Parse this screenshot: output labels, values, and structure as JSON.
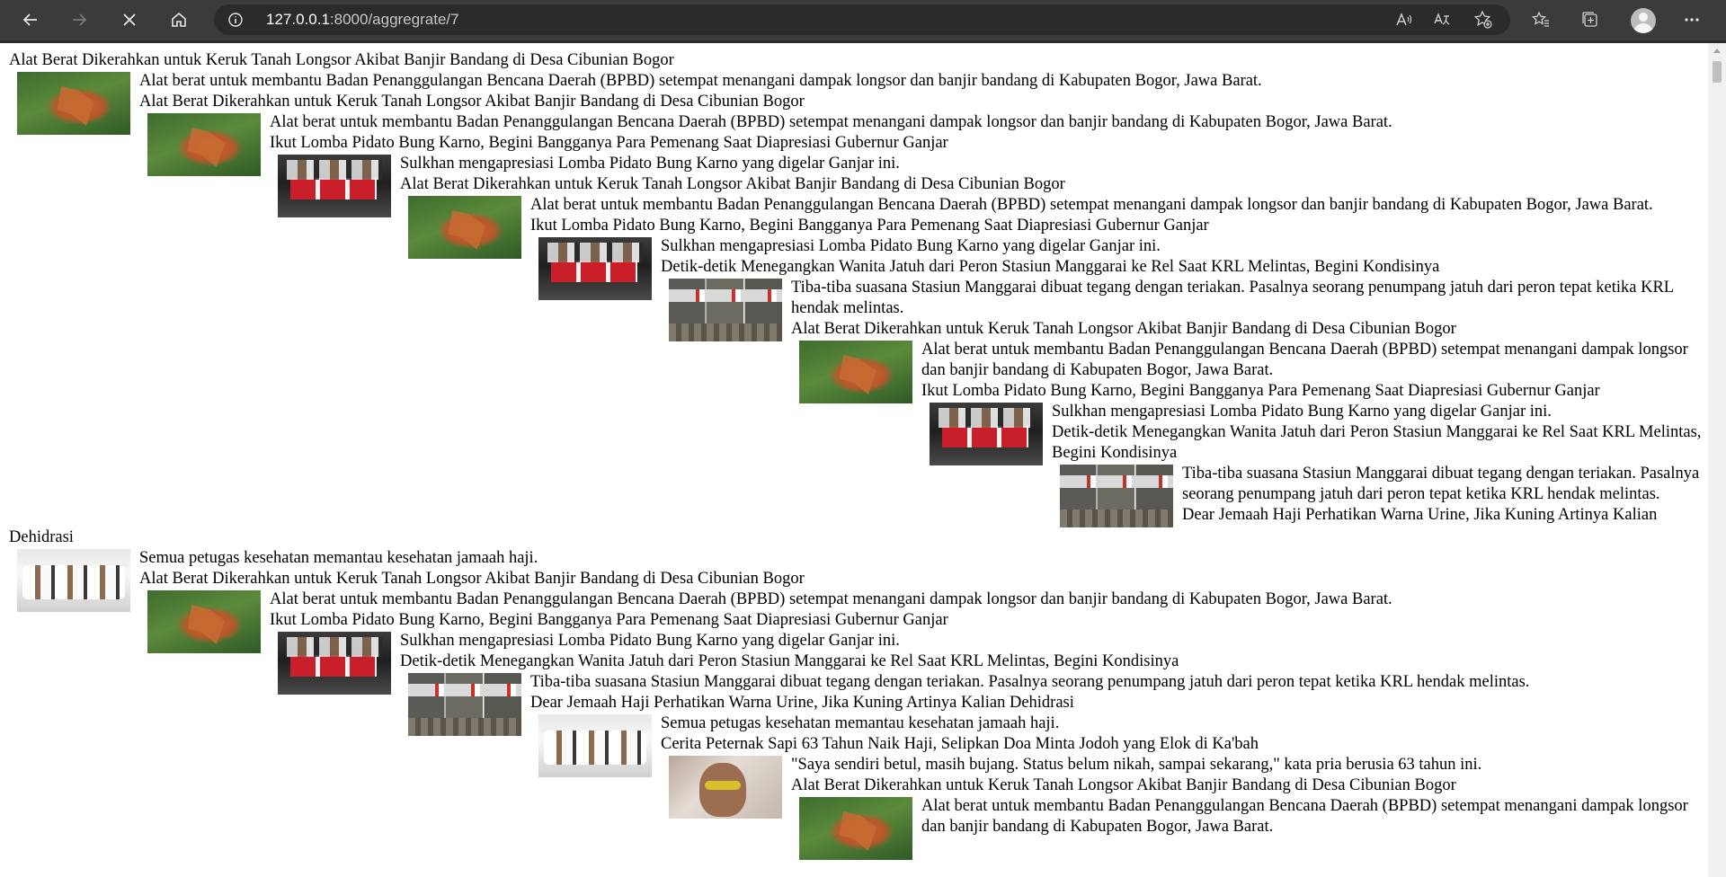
{
  "browser": {
    "url_host": "127.0.0.1",
    "url_rest": ":8000/aggregrate/7"
  },
  "articles": {
    "longsor": {
      "title": "Alat Berat Dikerahkan untuk Keruk Tanah Longsor Akibat Banjir Bandang di Desa Cibunian Bogor",
      "desc": "Alat berat untuk membantu Badan Penanggulangan Bencana Daerah (BPBD) setempat menangani dampak longsor dan banjir bandang di Kabupaten Bogor, Jawa Barat."
    },
    "pidato": {
      "title": "Ikut Lomba Pidato Bung Karno, Begini Bangganya Para Pemenang Saat Diapresiasi Gubernur Ganjar",
      "desc": "Sulkhan mengapresiasi Lomba Pidato Bung Karno yang digelar Ganjar ini."
    },
    "krl": {
      "title": "Detik-detik Menegangkan Wanita Jatuh dari Peron Stasiun Manggarai ke Rel Saat KRL Melintas, Begini Kondisinya",
      "desc": "Tiba-tiba suasana Stasiun Manggarai dibuat tegang dengan teriakan. Pasalnya seorang penumpang jatuh dari peron tepat ketika KRL hendak melintas."
    },
    "haji": {
      "title_partial": "Dear Jemaah Haji Perhatikan Warna Urine, Jika Kuning Artinya Kalian",
      "title_cont": "Dehidrasi",
      "title": "Dear Jemaah Haji Perhatikan Warna Urine, Jika Kuning Artinya Kalian Dehidrasi",
      "desc": "Semua petugas kesehatan memantau kesehatan jamaah haji."
    },
    "sapi": {
      "title": "Cerita Peternak Sapi 63 Tahun Naik Haji, Selipkan Doa Minta Jodoh yang Elok di Ka'bah",
      "desc": "\"Saya sendiri betul, masih bujang. Status belum nikah, sampai sekarang,\" kata pria berusia 63 tahun ini."
    }
  }
}
